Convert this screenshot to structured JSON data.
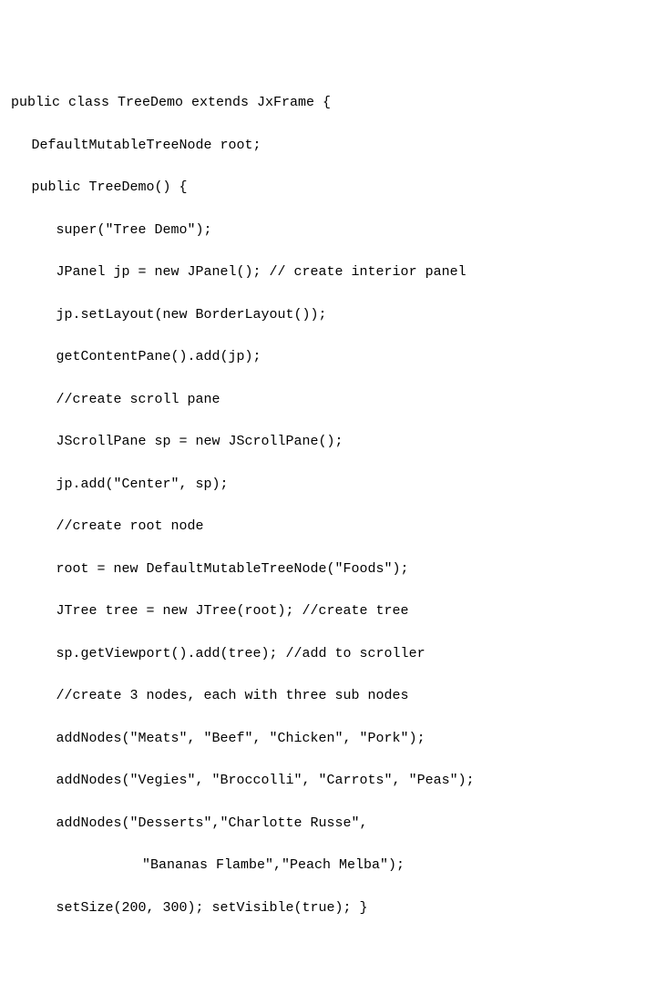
{
  "code": {
    "l1": "public class TreeDemo extends JxFrame {",
    "l2": "DefaultMutableTreeNode root;",
    "l3": "public TreeDemo() {",
    "l4": "super(\"Tree Demo\");",
    "l5": "JPanel jp = new JPanel(); // create interior panel",
    "l6": "jp.setLayout(new BorderLayout());",
    "l7": "getContentPane().add(jp);",
    "l8": "//create scroll pane",
    "l9": "JScrollPane sp = new JScrollPane();",
    "l10": "jp.add(\"Center\", sp);",
    "l11": "//create root node",
    "l12": "root = new DefaultMutableTreeNode(\"Foods\");",
    "l13": "JTree tree = new JTree(root); //create tree",
    "l14": "sp.getViewport().add(tree); //add to scroller",
    "l15": "//create 3 nodes, each with three sub nodes",
    "l16": "addNodes(\"Meats\", \"Beef\", \"Chicken\", \"Pork\");",
    "l17": "addNodes(\"Vegies\", \"Broccolli\", \"Carrots\", \"Peas\");",
    "l18": "addNodes(\"Desserts\",\"Charlotte Russe\",",
    "l19": "\"Bananas Flambe\",\"Peach Melba\");",
    "l20": "setSize(200, 300); setVisible(true); }"
  }
}
